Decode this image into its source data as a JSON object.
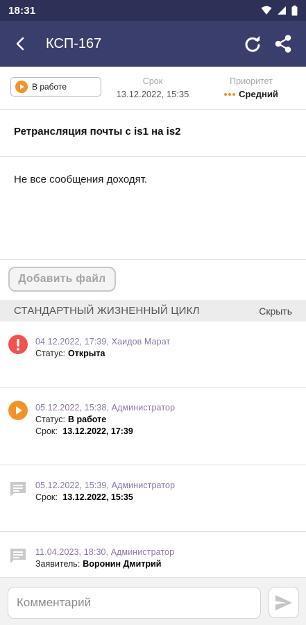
{
  "status_bar": {
    "time": "18:31"
  },
  "app_bar": {
    "title": "КСП-167"
  },
  "ticket": {
    "status": "В работе",
    "due_label": "Срок",
    "due_value": "13.12.2022, 15:35",
    "priority_label": "Приоритет",
    "priority_value": "Средний",
    "title": "Ретрансляция почты с is1 на is2",
    "description": "Не все сообщения доходят."
  },
  "add_file_label": "Добавить файл",
  "lifecycle": {
    "title": "СТАНДАРТНЫЙ ЖИЗНЕННЫЙ ЦИКЛ",
    "hide_label": "Скрыть",
    "events": [
      {
        "meta": "04.12.2022, 17:39, Хаидов Марат",
        "icon": "alert-icon",
        "lines": [
          {
            "key": "Статус:",
            "value": "Открыта"
          }
        ]
      },
      {
        "meta": "05.12.2022, 15:38, Администратор",
        "icon": "play-icon",
        "lines": [
          {
            "key": "Статус:",
            "value": "В работе"
          },
          {
            "key": "Срок:",
            "value": "13.12.2022, 17:39"
          }
        ]
      },
      {
        "meta": "05.12.2022, 15:39, Администратор",
        "icon": "comment-icon",
        "lines": [
          {
            "key": "Срок:",
            "value": "13.12.2022, 15:35"
          }
        ]
      },
      {
        "meta": "11.04.2023, 18:30, Администратор",
        "icon": "comment-icon",
        "lines": [
          {
            "key": "Заявитель:",
            "value": "Воронин Дмитрий"
          }
        ]
      }
    ]
  },
  "comment": {
    "placeholder": "Комментарий",
    "value": ""
  },
  "colors": {
    "primary": "#3a3e6c",
    "status_bar": "#2d3158",
    "in_progress": "#f0932b",
    "open": "#ef5350",
    "meta_text": "#8b76a8"
  }
}
